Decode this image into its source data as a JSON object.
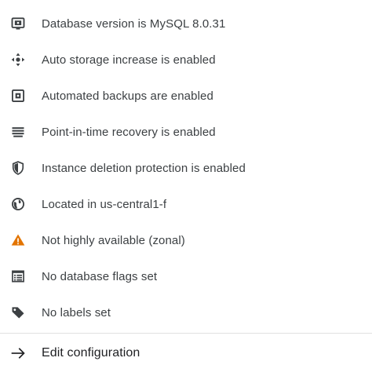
{
  "summary": {
    "items": [
      {
        "label": "Database version is MySQL 8.0.31",
        "icon": "database-version-icon"
      },
      {
        "label": "Auto storage increase is enabled",
        "icon": "storage-expand-icon"
      },
      {
        "label": "Automated backups are enabled",
        "icon": "backup-icon"
      },
      {
        "label": "Point-in-time recovery is enabled",
        "icon": "recovery-log-icon"
      },
      {
        "label": "Instance deletion protection is enabled",
        "icon": "shield-icon"
      },
      {
        "label": "Located in us-central1-f",
        "icon": "globe-icon"
      },
      {
        "label": "Not highly available (zonal)",
        "icon": "warning-icon"
      },
      {
        "label": "No database flags set",
        "icon": "flags-list-icon"
      },
      {
        "label": "No labels set",
        "icon": "label-tag-icon"
      }
    ],
    "action": {
      "label": "Edit configuration",
      "icon": "arrow-right-icon"
    }
  },
  "colors": {
    "icon": "#3c4043",
    "warning": "#e37400",
    "text": "#3c4043"
  }
}
